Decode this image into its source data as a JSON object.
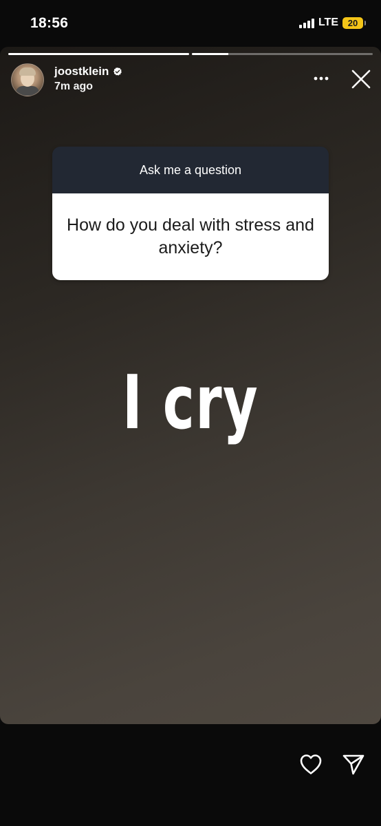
{
  "status_bar": {
    "time": "18:56",
    "network": "LTE",
    "battery": "20",
    "battery_color": "#f4c518"
  },
  "story": {
    "progress": [
      1.0,
      0.2
    ],
    "username": "joostklein",
    "time_ago": "7m ago",
    "verified": true,
    "sticker": {
      "header": "Ask me a question",
      "question": "How do you deal with stress and anxiety?"
    },
    "answer_text": "I cry"
  },
  "icons": {
    "more": "more-horizontal-icon",
    "close": "close-icon",
    "like": "heart-icon",
    "share": "send-icon"
  }
}
